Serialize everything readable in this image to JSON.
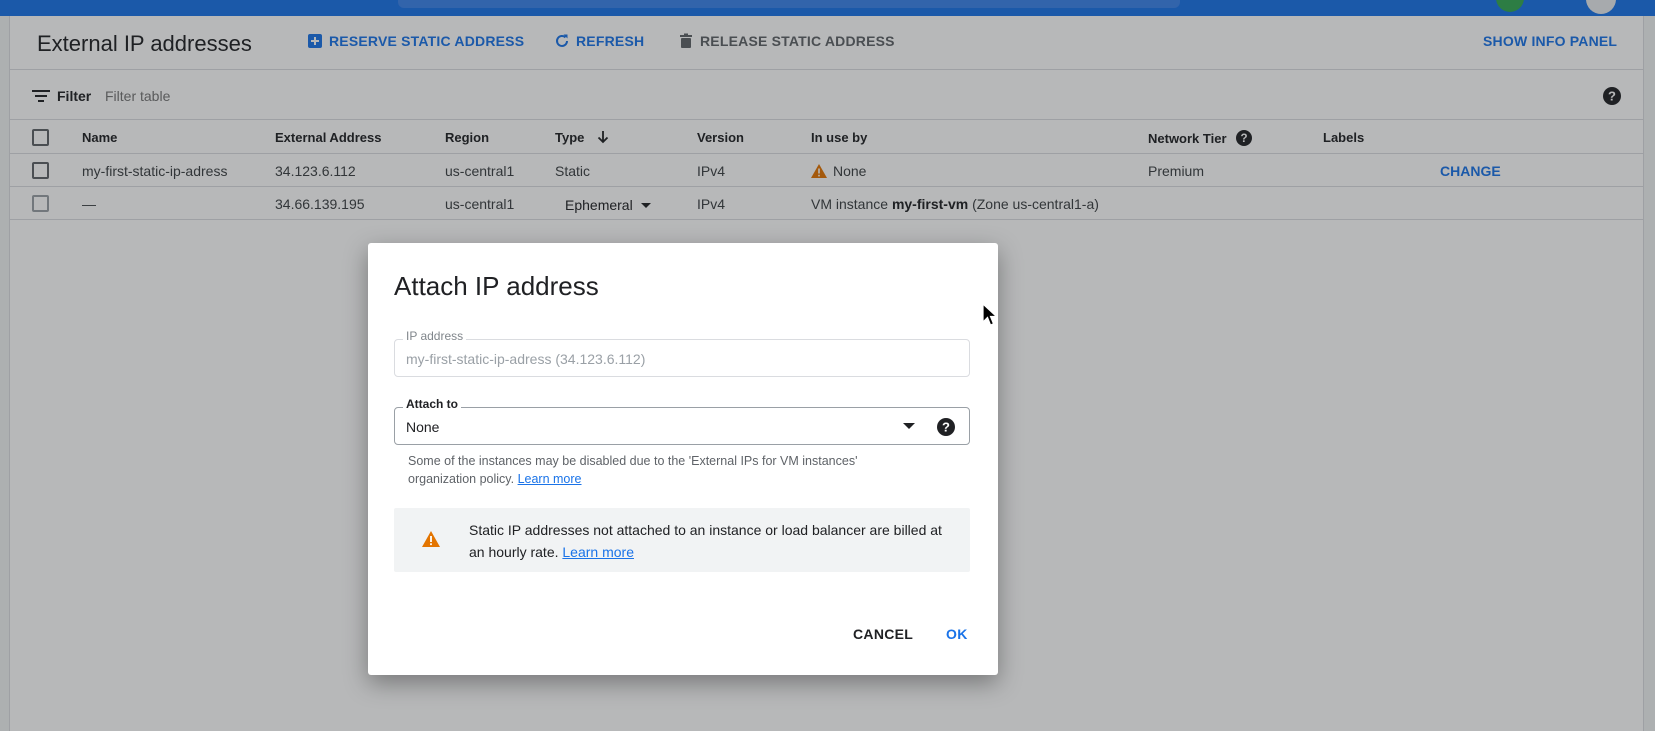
{
  "page": {
    "title": "External IP addresses",
    "actions": {
      "reserve": "RESERVE STATIC ADDRESS",
      "refresh": "REFRESH",
      "release": "RELEASE STATIC ADDRESS",
      "info_panel": "SHOW INFO PANEL"
    }
  },
  "filter": {
    "label": "Filter",
    "placeholder": "Filter table"
  },
  "table": {
    "headers": {
      "name": "Name",
      "external_address": "External Address",
      "region": "Region",
      "type": "Type",
      "version": "Version",
      "in_use_by": "In use by",
      "network_tier": "Network Tier",
      "labels": "Labels"
    },
    "rows": [
      {
        "name": "my-first-static-ip-adress",
        "external_address": "34.123.6.112",
        "region": "us-central1",
        "type": "Static",
        "version": "IPv4",
        "in_use_by": "None",
        "network_tier": "Premium",
        "action": "CHANGE"
      },
      {
        "name": "—",
        "external_address": "34.66.139.195",
        "region": "us-central1",
        "type": "Ephemeral",
        "version": "IPv4",
        "in_use_prefix": "VM instance",
        "in_use_vm": "my-first-vm",
        "in_use_zone": "(Zone us-central1-a)"
      }
    ]
  },
  "dialog": {
    "title": "Attach IP address",
    "ip_field": {
      "label": "IP address",
      "value": "my-first-static-ip-adress (34.123.6.112)"
    },
    "attach_field": {
      "label": "Attach to",
      "value": "None"
    },
    "hint_text": "Some of the instances may be disabled due to the 'External IPs for VM instances' organization policy.",
    "hint_link": "Learn more",
    "notice_text": "Static IP addresses not attached to an instance or load balancer are billed at an hourly rate.",
    "notice_link": "Learn more",
    "cancel": "CANCEL",
    "ok": "OK"
  },
  "colors": {
    "accent": "#1a73e8",
    "warning": "#e37400",
    "overlay": "rgba(32,33,36,0.32)"
  },
  "icons": [
    "add-box-icon",
    "refresh-icon",
    "trash-icon",
    "filter-icon",
    "help-icon",
    "sort-arrow-down-icon",
    "warning-icon",
    "dropdown-caret-icon",
    "mouse-cursor-icon"
  ]
}
